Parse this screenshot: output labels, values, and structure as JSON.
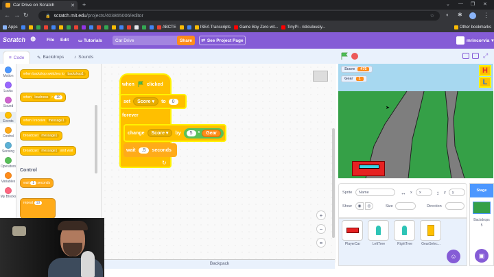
{
  "browser": {
    "tab_title": "Car Drive on Scratch",
    "url_host": "scratch.mit.edu",
    "url_path": "/projects/403865006/editor",
    "bookmarks": [
      "Apps",
      "",
      "",
      "",
      "",
      "",
      "",
      "",
      "",
      "",
      "",
      "",
      "",
      "",
      "",
      "",
      "",
      "",
      "",
      "ABCTE",
      "",
      "",
      "ISEA Transcripts",
      "Game Boy Zero wit...",
      "TinyPi - ridiculously..."
    ],
    "other_bookmarks": "Other bookmarks"
  },
  "menubar": {
    "logo": "Scratch",
    "file": "File",
    "edit": "Edit",
    "tutorials": "Tutorials",
    "project_title": "Car Drive",
    "share": "Share",
    "see_project": "See Project Page",
    "username": "mrincorvia"
  },
  "editor_tabs": {
    "code": "Code",
    "backdrops": "Backdrops",
    "sounds": "Sounds"
  },
  "categories": [
    {
      "label": "Motion",
      "color": "#4c97ff"
    },
    {
      "label": "Looks",
      "color": "#9966ff"
    },
    {
      "label": "Sound",
      "color": "#cf63cf"
    },
    {
      "label": "Events",
      "color": "#ffbf00"
    },
    {
      "label": "Control",
      "color": "#ffab19"
    },
    {
      "label": "Sensing",
      "color": "#5cb1d6"
    },
    {
      "label": "Operators",
      "color": "#59c059"
    },
    {
      "label": "Variables",
      "color": "#ff8c1a"
    },
    {
      "label": "My Blocks",
      "color": "#ff6680"
    }
  ],
  "palette": {
    "when_backdrop": "when backdrop switches to",
    "backdrop_value": "backdrop1",
    "when_key": "when",
    "key_value": "loudness",
    "gt": ">",
    "num10": "10",
    "when_receive": "when I receive",
    "message1": "message1",
    "broadcast": "broadcast",
    "broadcast_wait": "broadcast",
    "and_wait": "and wait",
    "control_header": "Control",
    "wait": "wait",
    "wait_val": "1",
    "seconds": "seconds",
    "repeat": "repeat",
    "repeat_val": "10"
  },
  "script": {
    "when": "when",
    "clicked": "clicked",
    "set": "set",
    "set_var": "Score",
    "to": "to",
    "set_val": "0",
    "forever": "forever",
    "change": "change",
    "change_var": "Score",
    "by": "by",
    "mult_a": "5",
    "mult_op": "*",
    "mult_b": "Gear",
    "wait": "wait",
    "wait_val": ".5",
    "seconds": "seconds"
  },
  "zoom": {
    "in": "+",
    "out": "−",
    "reset": "="
  },
  "backpack": "Backpack",
  "stage": {
    "monitors": [
      {
        "label": "Score",
        "value": "475"
      },
      {
        "label": "Gear",
        "value": "1"
      }
    ],
    "buttons": [
      "H",
      "L"
    ]
  },
  "sprite_info": {
    "sprite_label": "Sprite",
    "sprite_name": "Name",
    "x_label": "x",
    "x_val": "x",
    "y_label": "y",
    "y_val": "y",
    "show_label": "Show",
    "size_label": "Size",
    "direction_label": "Direction"
  },
  "sprites": [
    {
      "name": "PlayerCar"
    },
    {
      "name": "LeftTree"
    },
    {
      "name": "RightTree"
    },
    {
      "name": "GearSelec..."
    }
  ],
  "stage_panel": {
    "title": "Stage",
    "backdrops_label": "Backdrops",
    "backdrops_count": "5"
  }
}
